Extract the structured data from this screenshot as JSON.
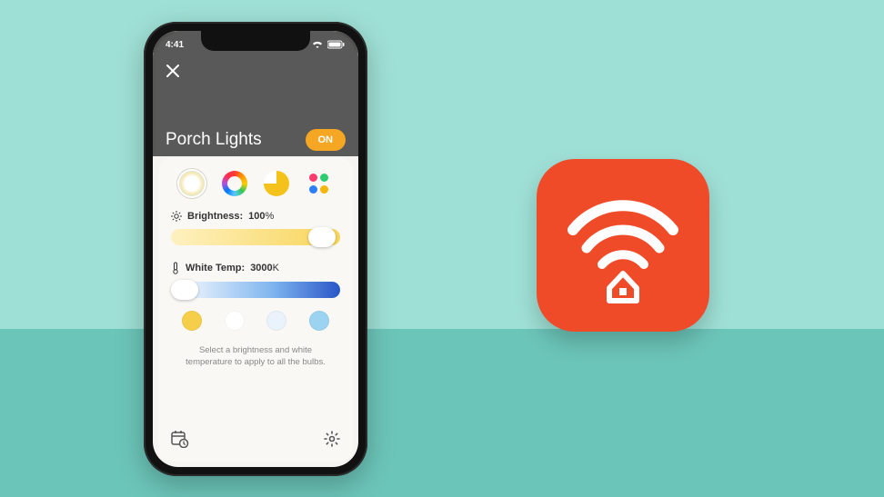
{
  "status": {
    "time": "4:41"
  },
  "screen": {
    "title": "Porch Lights",
    "power_label": "ON"
  },
  "brightness": {
    "label": "Brightness:",
    "value": "100",
    "unit": "%",
    "slider_pct": 92
  },
  "white_temp": {
    "label": "White Temp:",
    "value": "3000",
    "unit": "K",
    "slider_pct": 2
  },
  "presets": {
    "colors": [
      "#f6cf4a",
      "#ffffff",
      "#eaf3fb",
      "#9cd3f0"
    ]
  },
  "help": {
    "line1": "Select a brightness and white",
    "line2": "temperature to apply to all the bulbs."
  },
  "app_icon": {
    "bg": "#ef4b29"
  }
}
